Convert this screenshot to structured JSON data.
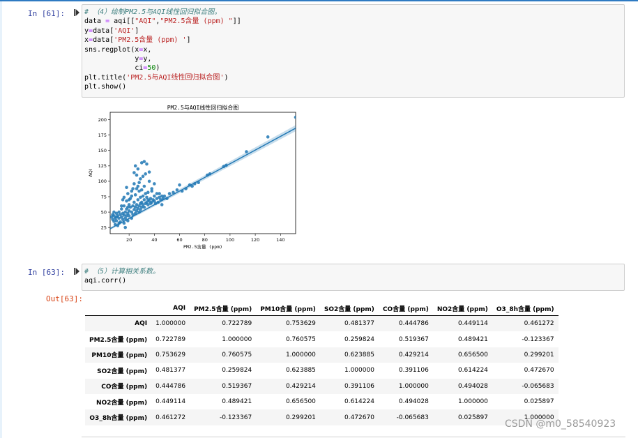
{
  "cell61": {
    "prompt": "In  [61]:",
    "code": [
      [
        {
          "c": "cm",
          "t": "# （4）绘制PM2.5与AQI线性回归拟合图。"
        }
      ],
      [
        {
          "t": "data "
        },
        {
          "c": "op",
          "t": "="
        },
        {
          "t": " aqi[["
        },
        {
          "c": "st",
          "t": "\"AQI\""
        },
        {
          "t": ","
        },
        {
          "c": "st",
          "t": "\"PM2.5含量 (ppm) \""
        },
        {
          "t": "]]"
        }
      ],
      [
        {
          "t": "y"
        },
        {
          "c": "op",
          "t": "="
        },
        {
          "t": "data["
        },
        {
          "c": "st",
          "t": "'AQI'"
        },
        {
          "t": "]"
        }
      ],
      [
        {
          "t": "x"
        },
        {
          "c": "op",
          "t": "="
        },
        {
          "t": "data["
        },
        {
          "c": "st",
          "t": "'PM2.5含量 (ppm) '"
        },
        {
          "t": "]"
        }
      ],
      [
        {
          "t": "sns.regplot(x"
        },
        {
          "c": "op",
          "t": "="
        },
        {
          "t": "x,"
        }
      ],
      [
        {
          "t": "            y"
        },
        {
          "c": "op",
          "t": "="
        },
        {
          "t": "y,"
        }
      ],
      [
        {
          "t": "            ci"
        },
        {
          "c": "op",
          "t": "="
        },
        {
          "c": "nm",
          "t": "50"
        },
        {
          "t": ")"
        }
      ],
      [
        {
          "t": "plt.title("
        },
        {
          "c": "st",
          "t": "'PM2.5与AQI线性回归拟合图'"
        },
        {
          "t": ")"
        }
      ],
      [
        {
          "t": "plt.show()"
        }
      ]
    ]
  },
  "chart_data": {
    "type": "scatter",
    "title": "PM2.5与AQI线性回归拟合图",
    "xlabel": "PM2.5含量 (ppm)",
    "ylabel": "AQI",
    "xlim": [
      5,
      152
    ],
    "ylim": [
      15,
      212
    ],
    "xticks": [
      20,
      40,
      60,
      80,
      100,
      120,
      140
    ],
    "yticks": [
      25,
      50,
      75,
      100,
      125,
      150,
      175,
      200
    ],
    "color": "#1f77b4",
    "regression": {
      "slope": 1.11,
      "intercept": 17.5
    },
    "points": [
      [
        6,
        42
      ],
      [
        7,
        38
      ],
      [
        7,
        46
      ],
      [
        8,
        35
      ],
      [
        8,
        44
      ],
      [
        9,
        40
      ],
      [
        9,
        30
      ],
      [
        10,
        48
      ],
      [
        10,
        36
      ],
      [
        11,
        44
      ],
      [
        11,
        28
      ],
      [
        12,
        40
      ],
      [
        12,
        50
      ],
      [
        13,
        34
      ],
      [
        13,
        46
      ],
      [
        14,
        42
      ],
      [
        14,
        55
      ],
      [
        15,
        38
      ],
      [
        15,
        48
      ],
      [
        16,
        45
      ],
      [
        16,
        60
      ],
      [
        16,
        32
      ],
      [
        17,
        50
      ],
      [
        17,
        25
      ],
      [
        17,
        40
      ],
      [
        18,
        55
      ],
      [
        18,
        68
      ],
      [
        18,
        44
      ],
      [
        19,
        48
      ],
      [
        19,
        80
      ],
      [
        19,
        36
      ],
      [
        20,
        52
      ],
      [
        20,
        62
      ],
      [
        20,
        44
      ],
      [
        21,
        58
      ],
      [
        21,
        72
      ],
      [
        22,
        50
      ],
      [
        22,
        84
      ],
      [
        22,
        40
      ],
      [
        23,
        60
      ],
      [
        23,
        46
      ],
      [
        24,
        54
      ],
      [
        24,
        66
      ],
      [
        24,
        96
      ],
      [
        25,
        48
      ],
      [
        25,
        58
      ],
      [
        25,
        78
      ],
      [
        26,
        52
      ],
      [
        26,
        62
      ],
      [
        26,
        88
      ],
      [
        27,
        56
      ],
      [
        27,
        70
      ],
      [
        27,
        120
      ],
      [
        28,
        60
      ],
      [
        28,
        50
      ],
      [
        28,
        98
      ],
      [
        29,
        64
      ],
      [
        29,
        74
      ],
      [
        29,
        54
      ],
      [
        30,
        66
      ],
      [
        30,
        86
      ],
      [
        30,
        58
      ],
      [
        31,
        62
      ],
      [
        31,
        76
      ],
      [
        31,
        108
      ],
      [
        32,
        70
      ],
      [
        32,
        58
      ],
      [
        32,
        92
      ],
      [
        33,
        64
      ],
      [
        33,
        80
      ],
      [
        33,
        112
      ],
      [
        34,
        66
      ],
      [
        34,
        74
      ],
      [
        35,
        70
      ],
      [
        35,
        62
      ],
      [
        35,
        82
      ],
      [
        36,
        68
      ],
      [
        36,
        115
      ],
      [
        37,
        64
      ],
      [
        37,
        72
      ],
      [
        38,
        66
      ],
      [
        38,
        88
      ],
      [
        39,
        70
      ],
      [
        40,
        68
      ],
      [
        40,
        76
      ],
      [
        41,
        64
      ],
      [
        42,
        72
      ],
      [
        43,
        66
      ],
      [
        44,
        74
      ],
      [
        45,
        70
      ],
      [
        46,
        62
      ],
      [
        47,
        72
      ],
      [
        48,
        76
      ],
      [
        50,
        72
      ],
      [
        52,
        80
      ],
      [
        55,
        82
      ],
      [
        58,
        86
      ],
      [
        60,
        94
      ],
      [
        62,
        84
      ],
      [
        65,
        88
      ],
      [
        68,
        94
      ],
      [
        70,
        92
      ],
      [
        72,
        96
      ],
      [
        75,
        98
      ],
      [
        82,
        110
      ],
      [
        84,
        112
      ],
      [
        95,
        124
      ],
      [
        97,
        126
      ],
      [
        113,
        148
      ],
      [
        130,
        172
      ],
      [
        152,
        204
      ],
      [
        25,
        125
      ],
      [
        30,
        130
      ],
      [
        34,
        128
      ],
      [
        28,
        84
      ],
      [
        22,
        76
      ],
      [
        18,
        90
      ],
      [
        20,
        70
      ],
      [
        16,
        74
      ],
      [
        14,
        60
      ],
      [
        40,
        96
      ],
      [
        36,
        100
      ],
      [
        42,
        80
      ],
      [
        24,
        114
      ],
      [
        32,
        132
      ],
      [
        26,
        110
      ],
      [
        38,
        84
      ],
      [
        44,
        80
      ],
      [
        46,
        76
      ],
      [
        12,
        32
      ],
      [
        10,
        42
      ],
      [
        8,
        50
      ],
      [
        15,
        70
      ],
      [
        19,
        58
      ],
      [
        23,
        88
      ],
      [
        27,
        92
      ],
      [
        29,
        104
      ]
    ]
  },
  "cell63": {
    "prompt": "In  [63]:",
    "out_prompt": "Out[63]:",
    "code": [
      [
        {
          "c": "cm",
          "t": "# （5）计算相关系数。"
        }
      ],
      [
        {
          "t": "aqi.corr()"
        }
      ]
    ]
  },
  "corr_table": {
    "columns": [
      "AQI",
      "PM2.5含量 (ppm)",
      "PM10含量 (ppm)",
      "SO2含量 (ppm)",
      "CO含量 (ppm)",
      "NO2含量 (ppm)",
      "O3_8h含量 (ppm)"
    ],
    "rows": [
      {
        "label": "AQI",
        "values": [
          "1.000000",
          "0.722789",
          "0.753629",
          "0.481377",
          "0.444786",
          "0.449114",
          "0.461272"
        ]
      },
      {
        "label": "PM2.5含量 (ppm)",
        "values": [
          "0.722789",
          "1.000000",
          "0.760575",
          "0.259824",
          "0.519367",
          "0.489421",
          "-0.123367"
        ]
      },
      {
        "label": "PM10含量 (ppm)",
        "values": [
          "0.753629",
          "0.760575",
          "1.000000",
          "0.623885",
          "0.429214",
          "0.656500",
          "0.299201"
        ]
      },
      {
        "label": "SO2含量 (ppm)",
        "values": [
          "0.481377",
          "0.259824",
          "0.623885",
          "1.000000",
          "0.391106",
          "0.614224",
          "0.472670"
        ]
      },
      {
        "label": "CO含量 (ppm)",
        "values": [
          "0.444786",
          "0.519367",
          "0.429214",
          "0.391106",
          "1.000000",
          "0.494028",
          "-0.065683"
        ]
      },
      {
        "label": "NO2含量 (ppm)",
        "values": [
          "0.449114",
          "0.489421",
          "0.656500",
          "0.614224",
          "0.494028",
          "1.000000",
          "0.025897"
        ]
      },
      {
        "label": "O3_8h含量 (ppm)",
        "values": [
          "0.461272",
          "-0.123367",
          "0.299201",
          "0.472670",
          "-0.065683",
          "0.025897",
          "1.000000"
        ]
      }
    ]
  },
  "watermark": "CSDN @m0_58540923"
}
